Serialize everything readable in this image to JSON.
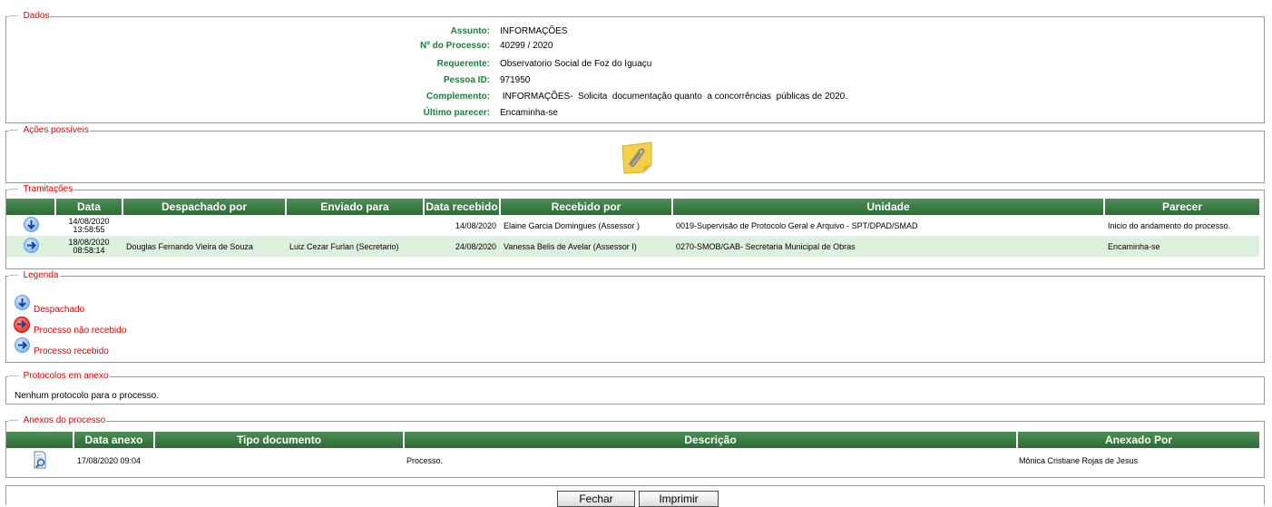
{
  "dados": {
    "legend": "Dados",
    "fields": [
      {
        "label": "Assunto:",
        "value": "INFORMAÇÕES"
      },
      {
        "label": "Nº do Processo:",
        "value": "40299 / 2020"
      },
      {
        "label": "Requerente:",
        "value": "Observatorio Social de Foz do Iguaçu"
      },
      {
        "label": "Pessoa ID:",
        "value": "971950"
      },
      {
        "label": "Complemento:",
        "value": " INFORMAÇÕES-  Solicita  documentação quanto  a concorrências  públicas de 2020."
      },
      {
        "label": "Último parecer:",
        "value": "Encaminha-se"
      }
    ]
  },
  "acoes": {
    "legend": "Ações possíveis",
    "icon": "sticky-note-paperclip-icon"
  },
  "tramitacoes": {
    "legend": "Tramitações",
    "headers": [
      "Data",
      "Despachado por",
      "Enviado para",
      "Data recebido",
      "Recebido por",
      "Unidade",
      "Parecer"
    ],
    "rows": [
      {
        "date": "14/08/2020",
        "time": "13:58:55",
        "despachado": "",
        "enviado": "",
        "data_recebido": "14/08/2020",
        "recebido": "Elaine Garcia Domingues (Assessor )",
        "unidade": "0019-Supervisão de Protocolo Geral e Arquivo - SPT/DPAD/SMAD",
        "parecer": "Inicio do andamento do processo."
      },
      {
        "date": "18/08/2020",
        "time": "08:58:14",
        "despachado": "Douglas Fernando Vieira de Souza",
        "enviado": "Luiz Cezar Furlan (Secretario)",
        "data_recebido": "24/08/2020",
        "recebido": "Vanessa Belis de Avelar (Assessor I)",
        "unidade": "0270-SMOB/GAB- Secretaria Municipal de Obras",
        "parecer": "Encaminha-se"
      }
    ]
  },
  "legenda": {
    "legend": "Legenda",
    "items": [
      "Despachado",
      "Processo não recebido",
      "Processo recebido"
    ]
  },
  "protocolos": {
    "legend": "Protocolos em anexo",
    "message": "Nenhum protocolo para o processo."
  },
  "anexos": {
    "legend": "Anexos do processo",
    "headers": [
      "Data anexo",
      "Tipo documento",
      "Descrição",
      "Anexado Por"
    ],
    "rows": [
      {
        "data": "17/08/2020 09:04",
        "tipo": "",
        "descricao": "Processo.",
        "anexado": "Mônica Cristiane Rojas de Jesus"
      }
    ]
  },
  "buttons": {
    "fechar": "Fechar",
    "imprimir": "Imprimir"
  }
}
